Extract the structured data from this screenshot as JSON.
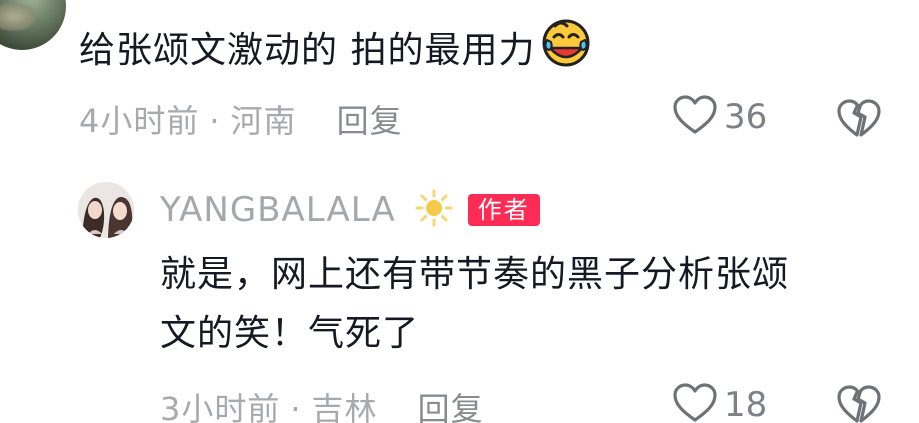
{
  "top_comment": {
    "text": "给张颂文激动的 拍的最用力",
    "emoji": "laughing-crying-emoji",
    "time": "4小时前",
    "separator": "·",
    "location": "河南",
    "reply_label": "回复",
    "like_count": "36"
  },
  "reply": {
    "author": "YANGBALALA",
    "badge": "作者",
    "text_line1": "就是，网上还有带节奏的黑子分析张颂",
    "text_line2": "文的笑！气死了",
    "time": "3小时前",
    "separator": "·",
    "location": "吉林",
    "reply_label": "回复",
    "like_count": "18"
  },
  "colors": {
    "text": "#161823",
    "meta": "#a8a9ae",
    "badge": "#fe2c55",
    "icon": "#6f7177"
  }
}
